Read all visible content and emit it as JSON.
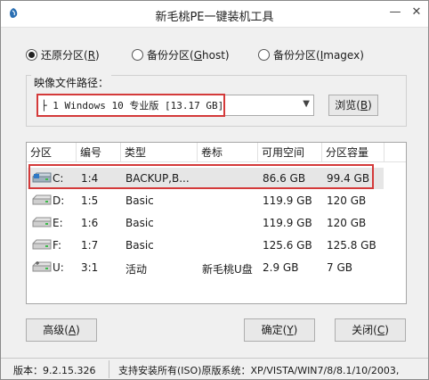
{
  "window": {
    "title": "新毛桃PE一键装机工具",
    "min_glyph": "—",
    "close_glyph": "✕"
  },
  "modes": [
    {
      "label": "还原分区",
      "hotkey": "R",
      "checked": true
    },
    {
      "label": "备份分区",
      "hotkey": "G",
      "suffix": "host",
      "checked": false
    },
    {
      "label": "备份分区",
      "hotkey": "I",
      "suffix": "magex",
      "checked": false
    }
  ],
  "image_path": {
    "label": "映像文件路径：",
    "value": "├ 1 Windows 10 专业版 [13.17 GB]",
    "browse_label": "浏览",
    "browse_hotkey": "B"
  },
  "table": {
    "columns": [
      "分区",
      "编号",
      "类型",
      "卷标",
      "可用空间",
      "分区容量"
    ],
    "rows": [
      {
        "drive": "C:",
        "id": "1:4",
        "type": "BACKUP,B...",
        "label": "",
        "free": "86.6 GB",
        "size": "99.4 GB",
        "selected": true
      },
      {
        "drive": "D:",
        "id": "1:5",
        "type": "Basic",
        "label": "",
        "free": "119.9 GB",
        "size": "120 GB",
        "selected": false
      },
      {
        "drive": "E:",
        "id": "1:6",
        "type": "Basic",
        "label": "",
        "free": "119.9 GB",
        "size": "120 GB",
        "selected": false
      },
      {
        "drive": "F:",
        "id": "1:7",
        "type": "Basic",
        "label": "",
        "free": "125.6 GB",
        "size": "125.8 GB",
        "selected": false
      },
      {
        "drive": "U:",
        "id": "3:1",
        "type": "活动",
        "label": "新毛桃U盘",
        "free": "2.9 GB",
        "size": "7 GB",
        "selected": false
      }
    ]
  },
  "buttons": {
    "advanced": {
      "label": "高级",
      "hotkey": "A"
    },
    "ok": {
      "label": "确定",
      "hotkey": "Y"
    },
    "close": {
      "label": "关闭",
      "hotkey": "C"
    }
  },
  "status": {
    "version": "版本：9.2.15.326",
    "info": "支持安装所有(ISO)原版系统：XP/VISTA/WIN7/8/8.1/10/2003,"
  },
  "colors": {
    "highlight": "#d43a3a",
    "selection": "#e6e6e6",
    "face": "#f0f0f0"
  }
}
